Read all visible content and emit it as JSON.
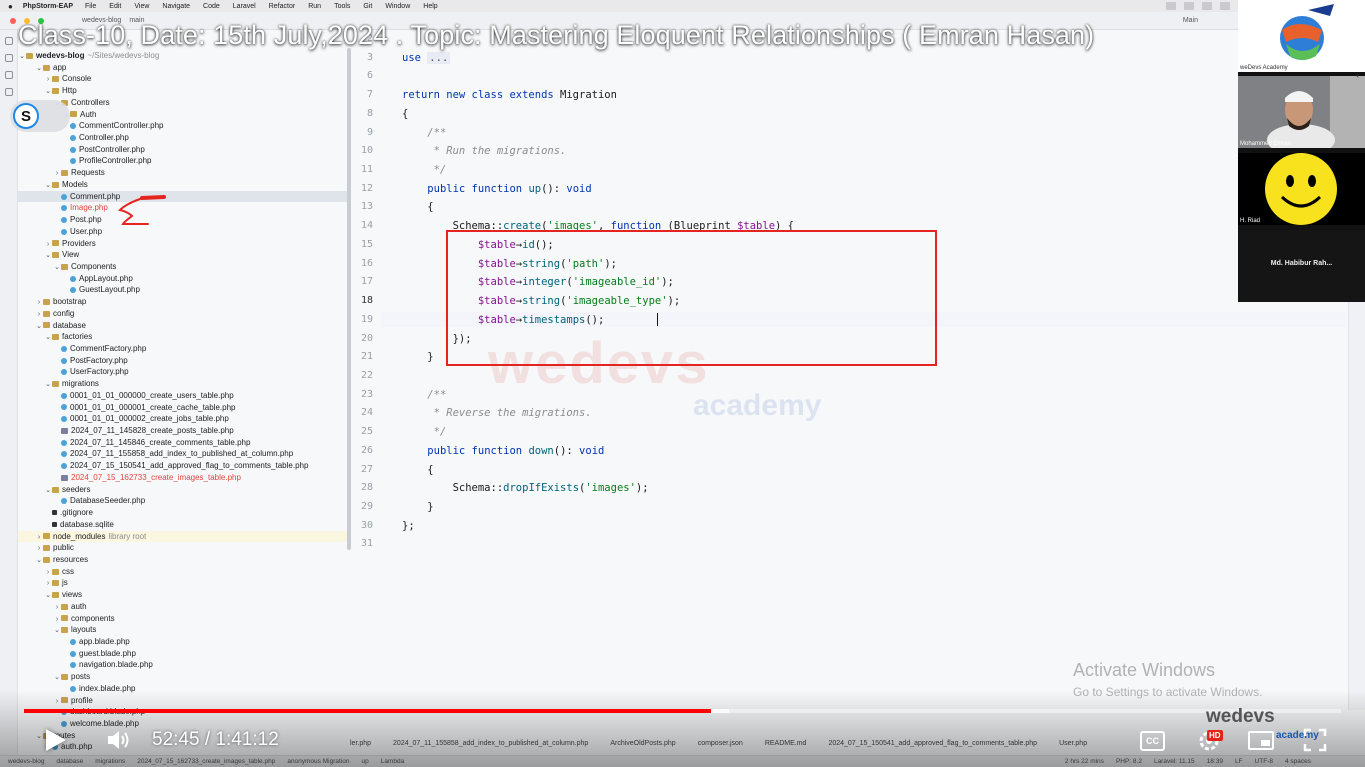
{
  "video": {
    "title": "Class-10, Date: 15th July,2024 . Topic: Mastering Eloquent Relationships ( Emran Hasan)",
    "current_time": "52:45",
    "duration": "1:41:12",
    "time_display": "52:45 / 1:41:12",
    "progress_fraction": 0.5213,
    "buffer_fraction": 0.535,
    "quality_badge": "HD",
    "cc_label": "CC",
    "progress_color": "#ff0000"
  },
  "menubar": {
    "app_name": "PhpStorm-EAP",
    "items": [
      "File",
      "Edit",
      "View",
      "Navigate",
      "Code",
      "Laravel",
      "Refactor",
      "Run",
      "Tools",
      "Git",
      "Window",
      "Help"
    ]
  },
  "toolbar": {
    "project": "wedevs-blog",
    "branch": "main",
    "run_config": "Main"
  },
  "tree": {
    "root_name": "wedevs-blog",
    "root_path": "~/Sites/wedevs-blog",
    "rows": [
      {
        "name": "app",
        "depth": 1,
        "kind": "folder",
        "open": true
      },
      {
        "name": "Console",
        "depth": 2,
        "kind": "folder",
        "open": false
      },
      {
        "name": "Http",
        "depth": 2,
        "kind": "folder",
        "open": true
      },
      {
        "name": "Controllers",
        "depth": 3,
        "kind": "folder",
        "open": true
      },
      {
        "name": "Auth",
        "depth": 4,
        "kind": "folder",
        "open": false
      },
      {
        "name": "CommentController.php",
        "depth": 4,
        "kind": "file"
      },
      {
        "name": "Controller.php",
        "depth": 4,
        "kind": "file"
      },
      {
        "name": "PostController.php",
        "depth": 4,
        "kind": "file"
      },
      {
        "name": "ProfileController.php",
        "depth": 4,
        "kind": "file"
      },
      {
        "name": "Requests",
        "depth": 3,
        "kind": "folder",
        "open": false
      },
      {
        "name": "Models",
        "depth": 2,
        "kind": "folder",
        "open": true
      },
      {
        "name": "Comment.php",
        "depth": 3,
        "kind": "file",
        "selected": true
      },
      {
        "name": "Image.php",
        "depth": 3,
        "kind": "file",
        "red": true
      },
      {
        "name": "Post.php",
        "depth": 3,
        "kind": "file"
      },
      {
        "name": "User.php",
        "depth": 3,
        "kind": "file"
      },
      {
        "name": "Providers",
        "depth": 2,
        "kind": "folder",
        "open": false
      },
      {
        "name": "View",
        "depth": 2,
        "kind": "folder",
        "open": true
      },
      {
        "name": "Components",
        "depth": 3,
        "kind": "folder",
        "open": true
      },
      {
        "name": "AppLayout.php",
        "depth": 4,
        "kind": "file"
      },
      {
        "name": "GuestLayout.php",
        "depth": 4,
        "kind": "file"
      },
      {
        "name": "bootstrap",
        "depth": 1,
        "kind": "folder",
        "open": false
      },
      {
        "name": "config",
        "depth": 1,
        "kind": "folder",
        "open": false
      },
      {
        "name": "database",
        "depth": 1,
        "kind": "folder",
        "open": true
      },
      {
        "name": "factories",
        "depth": 2,
        "kind": "folder",
        "open": true
      },
      {
        "name": "CommentFactory.php",
        "depth": 3,
        "kind": "file"
      },
      {
        "name": "PostFactory.php",
        "depth": 3,
        "kind": "file"
      },
      {
        "name": "UserFactory.php",
        "depth": 3,
        "kind": "file"
      },
      {
        "name": "migrations",
        "depth": 2,
        "kind": "folder",
        "open": true
      },
      {
        "name": "0001_01_01_000000_create_users_table.php",
        "depth": 3,
        "kind": "file"
      },
      {
        "name": "0001_01_01_000001_create_cache_table.php",
        "depth": 3,
        "kind": "file"
      },
      {
        "name": "0001_01_01_000002_create_jobs_table.php",
        "depth": 3,
        "kind": "file"
      },
      {
        "name": "2024_07_11_145828_create_posts_table.php",
        "depth": 3,
        "kind": "db"
      },
      {
        "name": "2024_07_11_145846_create_comments_table.php",
        "depth": 3,
        "kind": "file"
      },
      {
        "name": "2024_07_11_155858_add_index_to_published_at_column.php",
        "depth": 3,
        "kind": "file"
      },
      {
        "name": "2024_07_15_150541_add_approved_flag_to_comments_table.php",
        "depth": 3,
        "kind": "file"
      },
      {
        "name": "2024_07_15_162733_create_images_table.php",
        "depth": 3,
        "kind": "db",
        "red": true
      },
      {
        "name": "seeders",
        "depth": 2,
        "kind": "folder",
        "open": true
      },
      {
        "name": "DatabaseSeeder.php",
        "depth": 3,
        "kind": "file"
      },
      {
        "name": ".gitignore",
        "depth": 2,
        "kind": "ignore"
      },
      {
        "name": "database.sqlite",
        "depth": 2,
        "kind": "ignore"
      },
      {
        "name": "node_modules",
        "depth": 1,
        "kind": "folder",
        "open": false,
        "suffix": "library root",
        "highlight": true
      },
      {
        "name": "public",
        "depth": 1,
        "kind": "folder",
        "open": false
      },
      {
        "name": "resources",
        "depth": 1,
        "kind": "folder",
        "open": true
      },
      {
        "name": "css",
        "depth": 2,
        "kind": "folder",
        "open": false
      },
      {
        "name": "js",
        "depth": 2,
        "kind": "folder",
        "open": false
      },
      {
        "name": "views",
        "depth": 2,
        "kind": "folder",
        "open": true
      },
      {
        "name": "auth",
        "depth": 3,
        "kind": "folder",
        "open": false
      },
      {
        "name": "components",
        "depth": 3,
        "kind": "folder",
        "open": false
      },
      {
        "name": "layouts",
        "depth": 3,
        "kind": "folder",
        "open": true
      },
      {
        "name": "app.blade.php",
        "depth": 4,
        "kind": "file"
      },
      {
        "name": "guest.blade.php",
        "depth": 4,
        "kind": "file"
      },
      {
        "name": "navigation.blade.php",
        "depth": 4,
        "kind": "file"
      },
      {
        "name": "posts",
        "depth": 3,
        "kind": "folder",
        "open": true
      },
      {
        "name": "index.blade.php",
        "depth": 4,
        "kind": "file"
      },
      {
        "name": "profile",
        "depth": 3,
        "kind": "folder",
        "open": false
      },
      {
        "name": "dashboard.blade.php",
        "depth": 3,
        "kind": "file"
      },
      {
        "name": "welcome.blade.php",
        "depth": 3,
        "kind": "file"
      },
      {
        "name": "routes",
        "depth": 1,
        "kind": "folder",
        "open": true
      },
      {
        "name": "auth.php",
        "depth": 2,
        "kind": "file"
      }
    ]
  },
  "editor": {
    "current_line": 18,
    "lines": [
      {
        "n": "2",
        "html": ""
      },
      {
        "n": "3",
        "html": "<span class='kw'>use</span> <span class='fold'>...</span>"
      },
      {
        "n": "6",
        "html": ""
      },
      {
        "n": "7",
        "html": "<span class='kw'>return new class extends</span> Migration"
      },
      {
        "n": "8",
        "html": "{"
      },
      {
        "n": "9",
        "html": "    <span class='cm'>/**</span>"
      },
      {
        "n": "10",
        "html": "     <span class='cm'>* Run the migrations.</span>"
      },
      {
        "n": "11",
        "html": "     <span class='cm'>*/</span>"
      },
      {
        "n": "12",
        "html": "    <span class='kw'>public function</span> <span class='fn'>up</span>(): <span class='kw'>void</span>"
      },
      {
        "n": "13",
        "html": "    {"
      },
      {
        "n": "14",
        "html": "        Schema::<span class='fn'>create</span>(<span class='str'>'images'</span>, <span class='kw'>function</span> (Blueprint <span class='var'>$table</span>) {"
      },
      {
        "n": "15",
        "html": "            <span class='var'>$table</span>→<span class='fn'>id</span>();"
      },
      {
        "n": "16",
        "html": "            <span class='var'>$table</span>→<span class='fn'>string</span>(<span class='str'>'path'</span>);"
      },
      {
        "n": "17",
        "html": "            <span class='var'>$table</span>→<span class='fn'>integer</span>(<span class='str'>'imageable_id'</span>);"
      },
      {
        "n": "18",
        "html": "            <span class='var'>$table</span>→<span class='fn'>string</span>(<span class='str'>'imageable_type'</span>);"
      },
      {
        "n": "19",
        "html": "            <span class='var'>$table</span>→<span class='fn'>timestamps</span>();"
      },
      {
        "n": "20",
        "html": "        });"
      },
      {
        "n": "21",
        "html": "    }"
      },
      {
        "n": "22",
        "html": ""
      },
      {
        "n": "23",
        "html": "    <span class='cm'>/**</span>"
      },
      {
        "n": "24",
        "html": "     <span class='cm'>* Reverse the migrations.</span>"
      },
      {
        "n": "25",
        "html": "     <span class='cm'>*/</span>"
      },
      {
        "n": "26",
        "html": "    <span class='kw'>public function</span> <span class='fn'>down</span>(): <span class='kw'>void</span>"
      },
      {
        "n": "27",
        "html": "    {"
      },
      {
        "n": "28",
        "html": "        Schema::<span class='fn'>dropIfExists</span>(<span class='str'>'images'</span>);"
      },
      {
        "n": "29",
        "html": "    }"
      },
      {
        "n": "30",
        "html": "};"
      },
      {
        "n": "31",
        "html": ""
      }
    ]
  },
  "watermark": {
    "brand": "wedevs",
    "sub": "academy"
  },
  "participants": [
    {
      "id": "logo",
      "name": "weDevs Academy"
    },
    {
      "id": "emran",
      "name": "Mohammed Emran"
    },
    {
      "id": "riad",
      "name": "H. Riad"
    },
    {
      "id": "habib",
      "name": "Md. Habibur Rah..."
    }
  ],
  "activate_windows": {
    "title": "Activate Windows",
    "subtitle": "Go to Settings to activate Windows."
  },
  "bottom_tabs": [
    "ler.php",
    "2024_07_11_155858_add_index_to_published_at_column.php",
    "ArchiveOldPosts.php",
    "composer.json",
    "README.md",
    "2024_07_15_150541_add_approved_flag_to_comments_table.php",
    "User.php"
  ],
  "statusbar": {
    "crumbs": [
      "wedevs-blog",
      "database",
      "migrations",
      "2024_07_15_162733_create_images_table.php",
      "anonymous Migration",
      "up",
      "Lambda"
    ],
    "right": [
      "2 hrs 22 mins",
      "PHP: 8.2",
      "Laravel: 11.15",
      "18:39",
      "LF",
      "UTF-8",
      "4 spaces"
    ]
  },
  "corner_logo": {
    "brand": "wedevs",
    "sub": "academy"
  }
}
